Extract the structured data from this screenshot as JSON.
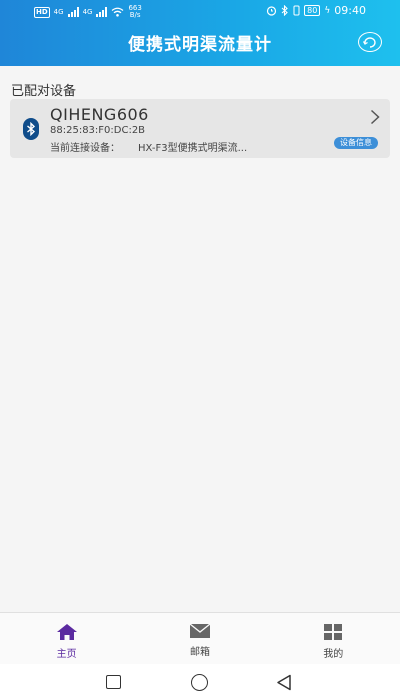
{
  "status_bar": {
    "hd_badge": "HD",
    "network_1": "4G",
    "network_2": "4G",
    "speed_value": "663",
    "speed_unit": "B/s",
    "battery": "80",
    "time": "09:40"
  },
  "header": {
    "title": "便携式明渠流量计"
  },
  "section": {
    "paired_title": "已配对设备"
  },
  "device": {
    "name": "QIHENG606",
    "mac": "88:25:83:F0:DC:2B",
    "connected_label": "当前连接设备：",
    "connected_value": "HX-F3型便携式明渠流...",
    "info_badge": "设备信息"
  },
  "tabs": [
    {
      "label": "主页",
      "active": true
    },
    {
      "label": "邮箱",
      "active": false
    },
    {
      "label": "我的",
      "active": false
    }
  ],
  "colors": {
    "header_gradient_start": "#1f86d8",
    "header_gradient_end": "#1ec0ee",
    "active_tab": "#5b2aa0",
    "bluetooth_icon_bg": "#0f4c8a",
    "info_badge_bg": "#3d8fd8"
  }
}
